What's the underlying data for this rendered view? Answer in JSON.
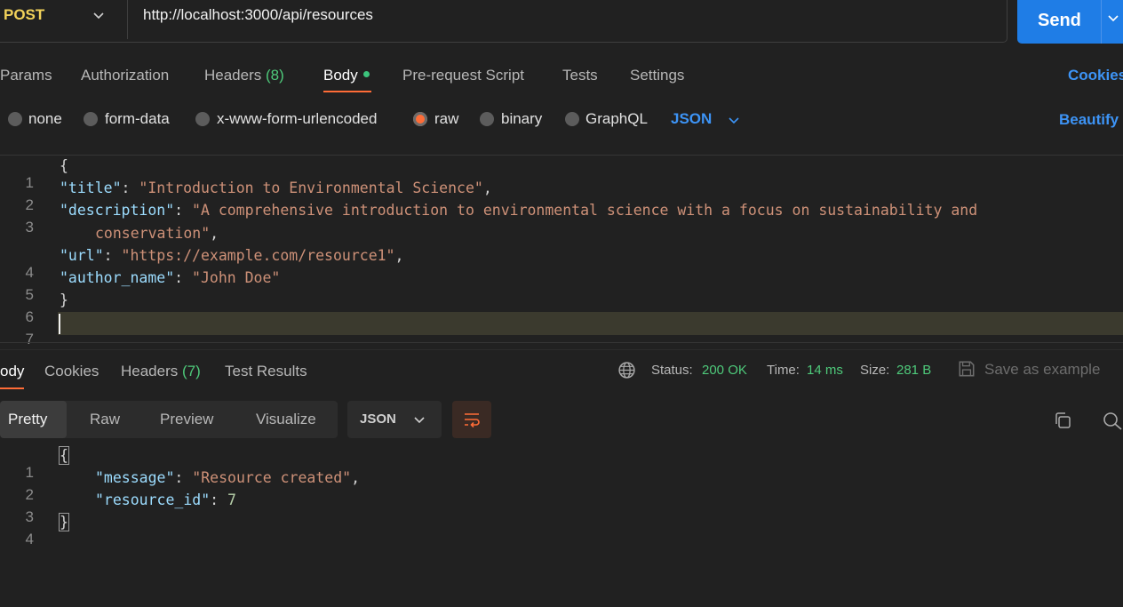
{
  "request": {
    "method": "POST",
    "url": "http://localhost:3000/api/resources",
    "send_label": "Send"
  },
  "request_tabs": {
    "params": "Params",
    "authorization": "Authorization",
    "headers": "Headers",
    "headers_count": "(8)",
    "body": "Body",
    "prerequest": "Pre-request Script",
    "tests": "Tests",
    "settings": "Settings",
    "cookies": "Cookies"
  },
  "body_types": {
    "none": "none",
    "form_data": "form-data",
    "urlencoded": "x-www-form-urlencoded",
    "raw": "raw",
    "binary": "binary",
    "graphql": "GraphQL",
    "format": "JSON",
    "beautify": "Beautify",
    "selected": "raw"
  },
  "request_body": {
    "line_numbers": [
      "1",
      "2",
      "3",
      "4",
      "5",
      "6",
      "7"
    ],
    "open_brace": "{",
    "close_brace": "}",
    "title_key": "\"title\"",
    "title_value": "\"Introduction to Environmental Science\"",
    "description_key": "\"description\"",
    "description_value_1": "\"A comprehensive introduction to environmental science with a focus on sustainability and",
    "description_value_2": "conservation\"",
    "url_key": "\"url\"",
    "url_value": "\"https://example.com/resource1\"",
    "author_key": "\"author_name\"",
    "author_value": "\"John Doe\""
  },
  "response_tabs": {
    "body": "ody",
    "cookies": "Cookies",
    "headers": "Headers",
    "headers_count": "(7)",
    "test_results": "Test Results"
  },
  "response_meta": {
    "status_label": "Status:",
    "status_value": "200 OK",
    "time_label": "Time:",
    "time_value": "14 ms",
    "size_label": "Size:",
    "size_value": "281 B",
    "save_example": "Save as example"
  },
  "response_view": {
    "pretty": "Pretty",
    "raw": "Raw",
    "preview": "Preview",
    "visualize": "Visualize",
    "format": "JSON"
  },
  "response_body": {
    "line_numbers": [
      "1",
      "2",
      "3",
      "4"
    ],
    "open_brace": "{",
    "close_brace": "}",
    "message_key": "\"message\"",
    "message_value": "\"Resource created\"",
    "id_key": "\"resource_id\"",
    "id_value": "7"
  },
  "colors": {
    "accent_orange": "#ff6c37",
    "send_blue": "#1f7de6",
    "status_green": "#4ec97a",
    "method_yellow": "#f2d25a"
  },
  "icons": [
    "chevron-down-icon",
    "globe-icon",
    "save-icon",
    "wrap-lines-icon",
    "copy-icon",
    "search-icon"
  ]
}
